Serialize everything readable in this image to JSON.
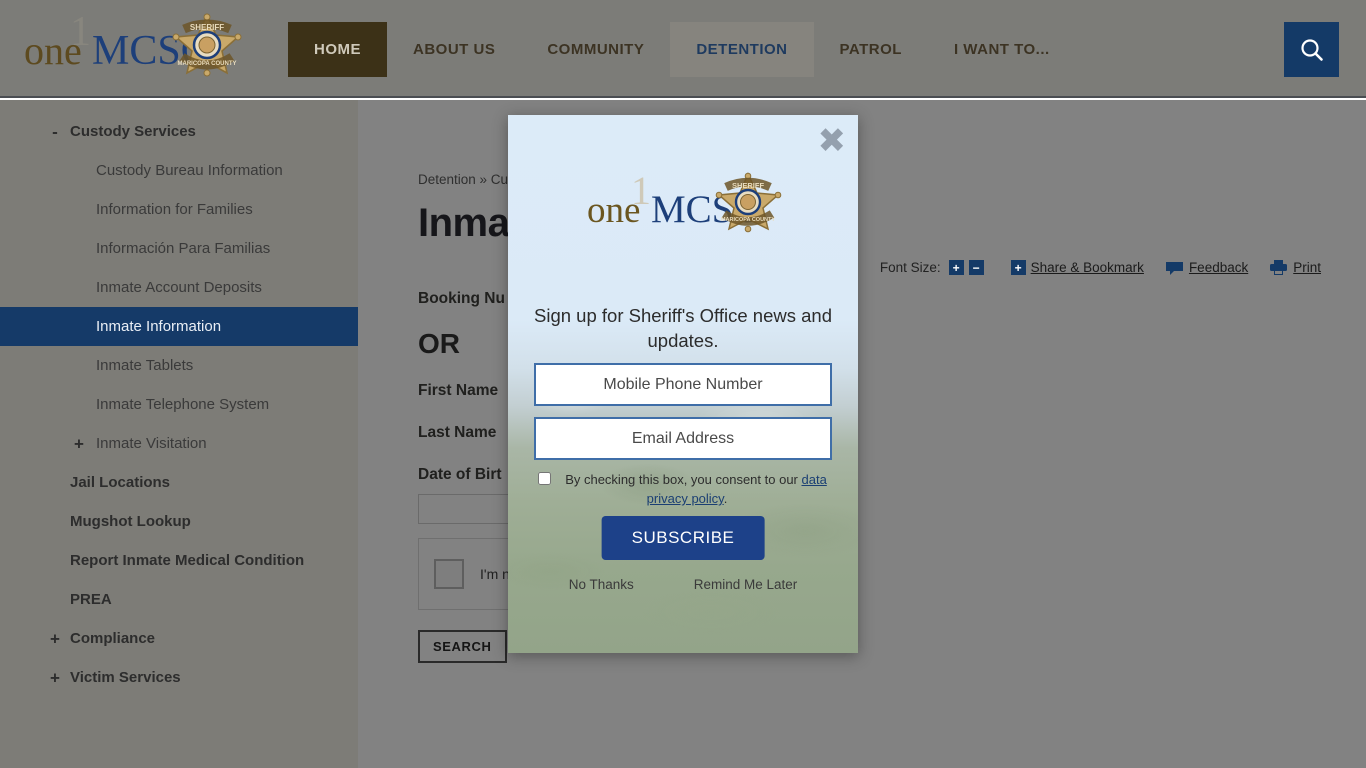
{
  "site": {
    "logo_text_one": "one",
    "logo_text_mcso": "MCSO",
    "badge_top": "SHERIFF",
    "badge_bottom": "MARICOPA COUNTY"
  },
  "nav": {
    "items": [
      {
        "label": "HOME",
        "state": "active-home"
      },
      {
        "label": "ABOUT US",
        "state": "normal"
      },
      {
        "label": "COMMUNITY",
        "state": "normal"
      },
      {
        "label": "DETENTION",
        "state": "active-section"
      },
      {
        "label": "PATROL",
        "state": "normal"
      },
      {
        "label": "I WANT TO...",
        "state": "normal"
      }
    ],
    "search_icon": "search-icon"
  },
  "sidebar": {
    "items": [
      {
        "label": "Custody Services",
        "toggle": "-",
        "level": "top"
      },
      {
        "label": "Custody Bureau Information",
        "toggle": "",
        "level": "sub"
      },
      {
        "label": "Information for Families",
        "toggle": "",
        "level": "sub"
      },
      {
        "label": "Información Para Familias",
        "toggle": "",
        "level": "sub"
      },
      {
        "label": "Inmate Account Deposits",
        "toggle": "",
        "level": "sub"
      },
      {
        "label": "Inmate Information",
        "toggle": "",
        "level": "sub",
        "active": true
      },
      {
        "label": "Inmate Tablets",
        "toggle": "",
        "level": "sub"
      },
      {
        "label": "Inmate Telephone System",
        "toggle": "",
        "level": "sub"
      },
      {
        "label": "Inmate Visitation",
        "toggle": "+",
        "level": "sub"
      },
      {
        "label": "Jail Locations",
        "toggle": "",
        "level": "top"
      },
      {
        "label": "Mugshot Lookup",
        "toggle": "",
        "level": "top"
      },
      {
        "label": "Report Inmate Medical Condition",
        "toggle": "",
        "level": "top"
      },
      {
        "label": "PREA",
        "toggle": "",
        "level": "top"
      },
      {
        "label": "Compliance",
        "toggle": "+",
        "level": "top"
      },
      {
        "label": "Victim Services",
        "toggle": "+",
        "level": "top"
      }
    ]
  },
  "main": {
    "breadcrumb": "Detention » Cus",
    "title": "Inma",
    "toolbar": {
      "font_size_label": "Font Size:",
      "increase": "+",
      "decrease": "−",
      "share_plus": "+",
      "share_label": "Share & Bookmark",
      "feedback_label": "Feedback",
      "print_label": "Print"
    },
    "form": {
      "booking_label": "Booking Nu",
      "or_label": "OR",
      "first_name_label": "First Name",
      "last_name_label": "Last Name",
      "dob_label": "Date of Birt",
      "dob_value": "",
      "captcha_text": "I'm no",
      "search_button": "SEARCH"
    }
  },
  "modal": {
    "close_icon": "close-icon",
    "headline": "Sign up for Sheriff's Office news and updates.",
    "phone_placeholder": "Mobile Phone Number",
    "phone_value": "",
    "email_placeholder": "Email Address",
    "email_value": "",
    "consent_prefix": "By checking this box, you consent to our ",
    "consent_link": "data privacy policy",
    "consent_suffix": ".",
    "subscribe_label": "SUBSCRIBE",
    "no_thanks_label": "No Thanks",
    "remind_label": "Remind Me Later"
  },
  "colors": {
    "nav_home_bg": "#3c3117",
    "nav_detention_bg": "#86847e",
    "search_bg": "#143a67",
    "sidebar_active_bg": "#153a68",
    "subscribe_bg": "#1d4189",
    "modal_input_border": "#3f6ea8",
    "overlay": "rgba(0,0,0,0.5)"
  }
}
